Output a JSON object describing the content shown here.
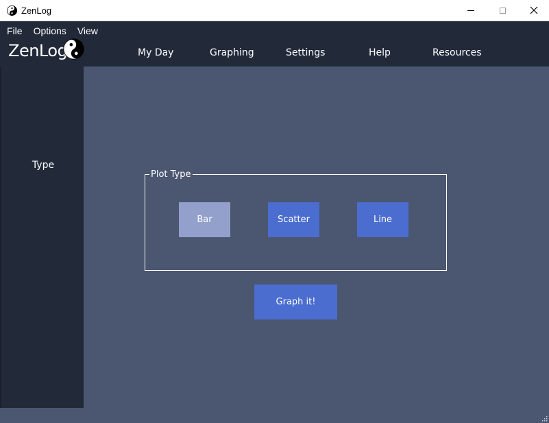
{
  "window": {
    "title": "ZenLog",
    "icon": "yin-yang-icon"
  },
  "menu": {
    "file": "File",
    "options": "Options",
    "view": "View"
  },
  "brand": {
    "name": "ZenLog",
    "icon": "yin-yang-icon"
  },
  "nav": {
    "my_day": "My Day",
    "graphing": "Graphing",
    "settings": "Settings",
    "help": "Help",
    "resources": "Resources"
  },
  "sidebar": {
    "type_label": "Type"
  },
  "plot": {
    "group_label": "Plot Type",
    "bar_label": "Bar",
    "scatter_label": "Scatter",
    "line_label": "Line",
    "graph_button": "Graph it!"
  },
  "colors": {
    "header_bg": "#222a3a",
    "content_bg": "#4b5670",
    "button": "#4a6dcf",
    "button_selected": "#93a0cc"
  }
}
